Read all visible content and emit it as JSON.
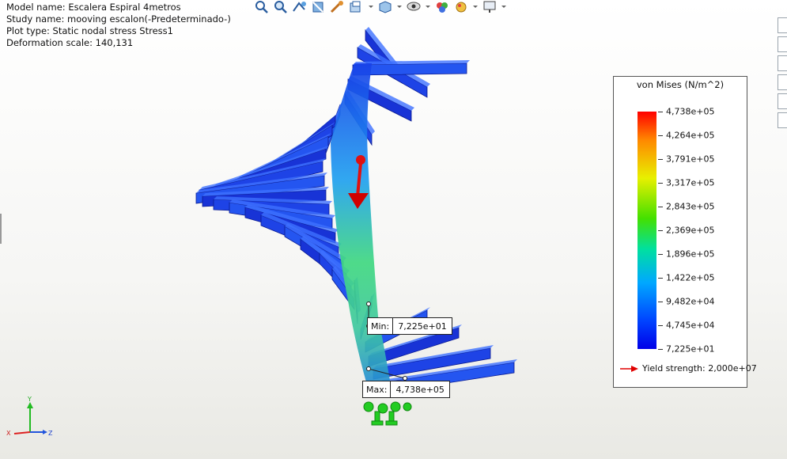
{
  "info": {
    "model_name": "Model name: Escalera Espiral 4metros",
    "study_name": "Study name: mooving escalon(-Predeterminado-)",
    "plot_type": "Plot type: Static nodal stress Stress1",
    "deformation_scale": "Deformation scale: 140,131"
  },
  "toolbar": {
    "icons": [
      "zoom-to-fit-icon",
      "zoom-area-icon",
      "previous-view-icon",
      "section-view-icon",
      "view-analysis-icon",
      "display-style-icon",
      "view-orientation-icon",
      "hide-show-icon",
      "edit-appearance-icon",
      "scene-icon",
      "display-settings-icon"
    ]
  },
  "legend": {
    "title": "von Mises (N/m^2)",
    "ticks": [
      "4,738e+05",
      "4,264e+05",
      "3,791e+05",
      "3,317e+05",
      "2,843e+05",
      "2,369e+05",
      "1,896e+05",
      "1,422e+05",
      "9,482e+04",
      "4,745e+04",
      "7,225e+01"
    ],
    "yield_label": "Yield strength: 2,000e+07",
    "colors": {
      "max": "#ff0000",
      "min": "#0000e8",
      "yield_arrow": "#e00000"
    }
  },
  "probes": {
    "min": {
      "key": "Min:",
      "value": "7,225e+01"
    },
    "max": {
      "key": "Max:",
      "value": "4,738e+05"
    }
  },
  "triad": {
    "y": "Y",
    "x": "X",
    "z": "Z"
  }
}
